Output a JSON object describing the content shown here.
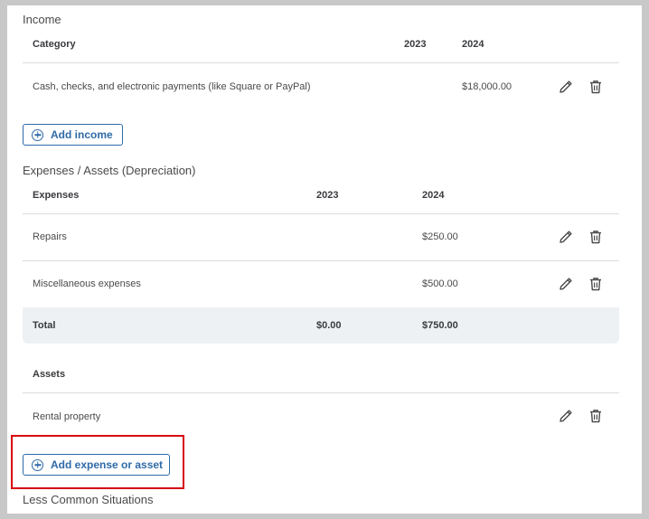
{
  "income": {
    "title": "Income",
    "headers": {
      "category": "Category",
      "y2023": "2023",
      "y2024": "2024"
    },
    "rows": [
      {
        "label": "Cash, checks, and electronic payments (like Square or PayPal)",
        "y2023": "",
        "y2024": "$18,000.00"
      }
    ],
    "add_button": "Add income"
  },
  "expenses": {
    "title": "Expenses / Assets (Depreciation)",
    "headers": {
      "category": "Expenses",
      "y2023": "2023",
      "y2024": "2024"
    },
    "rows": [
      {
        "label": "Repairs",
        "y2023": "",
        "y2024": "$250.00"
      },
      {
        "label": "Miscellaneous expenses",
        "y2023": "",
        "y2024": "$500.00"
      }
    ],
    "total": {
      "label": "Total",
      "y2023": "$0.00",
      "y2024": "$750.00"
    }
  },
  "assets": {
    "header": "Assets",
    "rows": [
      {
        "label": "Rental property"
      }
    ],
    "add_button": "Add expense or asset"
  },
  "less_common": {
    "title": "Less Common Situations"
  },
  "icons": {
    "edit": "pencil-icon",
    "delete": "trash-icon",
    "add": "plus-circle-icon"
  },
  "colors": {
    "accent": "#2e6aa8",
    "highlight": "#d7000f",
    "total_bg": "#eef1f4"
  }
}
